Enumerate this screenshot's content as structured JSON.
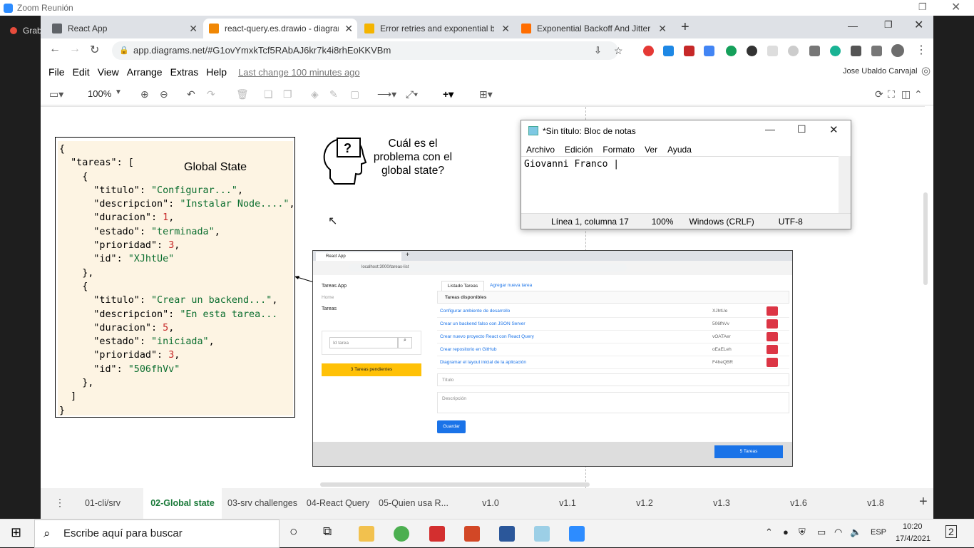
{
  "zoom": {
    "title": "Zoom Reunión",
    "recording": "Grabación"
  },
  "tabs": [
    {
      "label": "React App",
      "color": "#5f6368"
    },
    {
      "label": "react-query.es.drawio - diagrams",
      "color": "#f08705"
    },
    {
      "label": "Error retries and exponential backoff",
      "color": "#f4b400"
    },
    {
      "label": "Exponential Backoff And Jitter | AWS",
      "color": "#ff6d00"
    }
  ],
  "address": {
    "url": "app.diagrams.net/#G1ovYmxkTcf5RAbAJ6kr7k4i8rhEoKKVBm"
  },
  "menu": {
    "items": [
      "File",
      "Edit",
      "View",
      "Arrange",
      "Extras",
      "Help"
    ],
    "last_change": "Last change 100 minutes ago",
    "user": "Jose Ubaldo Carvajal"
  },
  "toolbar": {
    "zoom": "100%"
  },
  "diagram": {
    "state_title": "Global State",
    "question": "Cuál es el problema con el global state?",
    "json_lines": [
      "{",
      "  \"tareas\": [",
      "    {",
      "      \"titulo\": \"Configurar...\",",
      "      \"descripcion\": \"Instalar Node....\",",
      "      \"duracion\": 1,",
      "      \"estado\": \"terminada\",",
      "      \"prioridad\": 3,",
      "      \"id\": \"XJhtUe\"",
      "    },",
      "    {",
      "      \"titulo\": \"Crear un backend...\",",
      "      \"descripcion\": \"En esta tarea...",
      "      \"duracion\": 5,",
      "      \"estado\": \"iniciada\",",
      "      \"prioridad\": 3,",
      "      \"id\": \"506fhVv\"",
      "    },",
      "  ]",
      "}"
    ]
  },
  "shot": {
    "tab": "React App",
    "url": "localhost:3000/tareas-list",
    "sidebar": {
      "title": "Tareas App",
      "home": "Home",
      "tareas": "Tareas",
      "search_placeholder": "Id tarea",
      "pending": "3  Tareas pendientes"
    },
    "tabs": [
      "Listado Tareas",
      "Agregar nueva tarea"
    ],
    "panel_title": "Tareas disponibles",
    "rows": [
      {
        "name": "Configurar ambiente de desarrollo",
        "id": "XJhtUe"
      },
      {
        "name": "Crear un backend falso con JSON Server",
        "id": "506fhVv"
      },
      {
        "name": "Crear nuevo proyecto React con React Query",
        "id": "vOATAer"
      },
      {
        "name": "Crear repositorio en GitHub",
        "id": "oEaELeh"
      },
      {
        "name": "Diagramar el layout inicial de la aplicación",
        "id": "F4heQBR"
      }
    ],
    "titulo_placeholder": "Título",
    "descripcion_placeholder": "Descripción",
    "save": "Guardar",
    "footer_btn": "5  Tareas"
  },
  "notepad": {
    "title": "*Sin título: Bloc de notas",
    "menu": [
      "Archivo",
      "Edición",
      "Formato",
      "Ver",
      "Ayuda"
    ],
    "content": "Giovanni Franco |",
    "status": [
      "Línea 1, columna 17",
      "100%",
      "Windows (CRLF)",
      "UTF-8"
    ]
  },
  "pages": [
    "01-cli/srv",
    "02-Global state",
    "03-srv challenges",
    "04-React Query",
    "05-Quien usa R...",
    "v1.0",
    "v1.1",
    "v1.2",
    "v1.3",
    "v1.6",
    "v1.8"
  ],
  "taskbar": {
    "search": "Escribe aquí para buscar",
    "lang": "ESP",
    "time": "10:20",
    "date": "17/4/2021",
    "notifications": "2"
  }
}
